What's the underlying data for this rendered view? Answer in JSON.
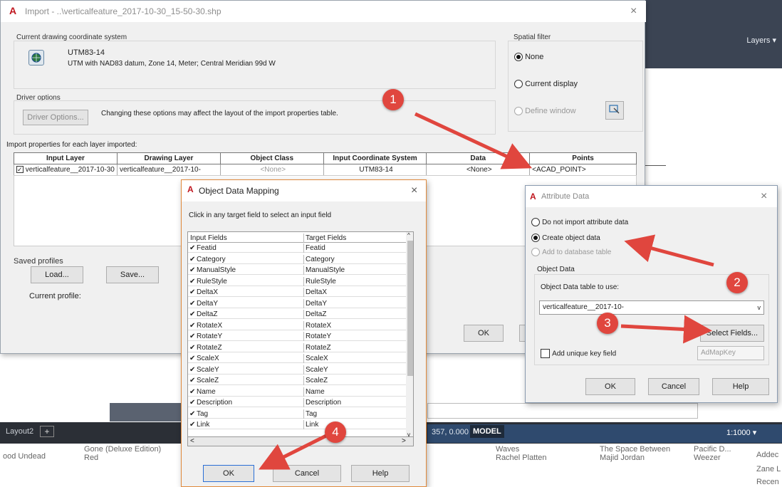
{
  "background": {
    "ribbon_layers": "Layers ▾",
    "taskbar": {
      "layout_tab": "Layout2",
      "plus": "+",
      "coords": "357, 0.000",
      "model": "MODEL",
      "scale": "1:1000 ▾"
    },
    "music": [
      {
        "title": "Gone (Deluxe Edition)",
        "sub": "Red",
        "left": "ood Undead"
      },
      {
        "title": "Waves",
        "sub": "Rachel Platten"
      },
      {
        "title": "The Space Between",
        "sub": "Majid Jordan"
      },
      {
        "title": "Pacific D...",
        "sub": "Weezer"
      },
      {
        "title": "Addec",
        "sub": "Zane L"
      },
      {
        "title": "Recen",
        "sub": ""
      }
    ]
  },
  "import_dialog": {
    "title": "Import - ..\\verticalfeature_2017-10-30_15-50-30.shp",
    "close": "×",
    "coord_group_title": "Current drawing coordinate system",
    "coord_name": "UTM83-14",
    "coord_desc": "UTM with NAD83 datum, Zone 14, Meter; Central Meridian 99d W",
    "spatial_title": "Spatial filter",
    "spatial_options": [
      "None",
      "Current display",
      "Define window"
    ],
    "driver_title": "Driver options",
    "driver_button": "Driver Options...",
    "driver_note": "Changing these options may affect the layout of the import properties table.",
    "import_props_label": "Import properties for each layer imported:",
    "table": {
      "headers": [
        "Input Layer",
        "Drawing Layer",
        "Object Class",
        "Input Coordinate System",
        "Data",
        "Points"
      ],
      "row": [
        "verticalfeature__2017-10-30",
        "verticalfeature__2017-10-",
        "<None>",
        "UTM83-14",
        "<None>",
        "<ACAD_POINT>"
      ]
    },
    "saved_profiles": "Saved profiles",
    "load": "Load...",
    "save": "Save...",
    "current_profile": "Current profile:",
    "ok": "OK"
  },
  "odm_dialog": {
    "title": "Object Data Mapping",
    "close": "×",
    "instruction": "Click in any target field to select an input field",
    "headers": [
      "Input Fields",
      "Target Fields"
    ],
    "rows": [
      [
        "Featid",
        "Featid"
      ],
      [
        "Category",
        "Category"
      ],
      [
        "ManualStyle",
        "ManualStyle"
      ],
      [
        "RuleStyle",
        "RuleStyle"
      ],
      [
        "DeltaX",
        "DeltaX"
      ],
      [
        "DeltaY",
        "DeltaY"
      ],
      [
        "DeltaZ",
        "DeltaZ"
      ],
      [
        "RotateX",
        "RotateX"
      ],
      [
        "RotateY",
        "RotateY"
      ],
      [
        "RotateZ",
        "RotateZ"
      ],
      [
        "ScaleX",
        "ScaleX"
      ],
      [
        "ScaleY",
        "ScaleY"
      ],
      [
        "ScaleZ",
        "ScaleZ"
      ],
      [
        "Name",
        "Name"
      ],
      [
        "Description",
        "Description"
      ],
      [
        "Tag",
        "Tag"
      ],
      [
        "Link",
        "Link"
      ]
    ],
    "ok": "OK",
    "cancel": "Cancel",
    "help": "Help"
  },
  "attr_dialog": {
    "title": "Attribute Data",
    "close": "×",
    "options": [
      "Do not import attribute data",
      "Create object data",
      "Add to database table"
    ],
    "od_group_title": "Object Data",
    "table_label": "Object Data table to use:",
    "table_value": "verticalfeature__2017-10-",
    "select_fields": "Select Fields...",
    "unique_key": "Add unique key field",
    "key_value": "AdMapKey",
    "ok": "OK",
    "cancel": "Cancel",
    "help": "Help"
  },
  "annotations": [
    "1",
    "2",
    "3",
    "4"
  ],
  "colors": {
    "annotation": "#e0463e",
    "autocad_logo": "#c0171f"
  }
}
